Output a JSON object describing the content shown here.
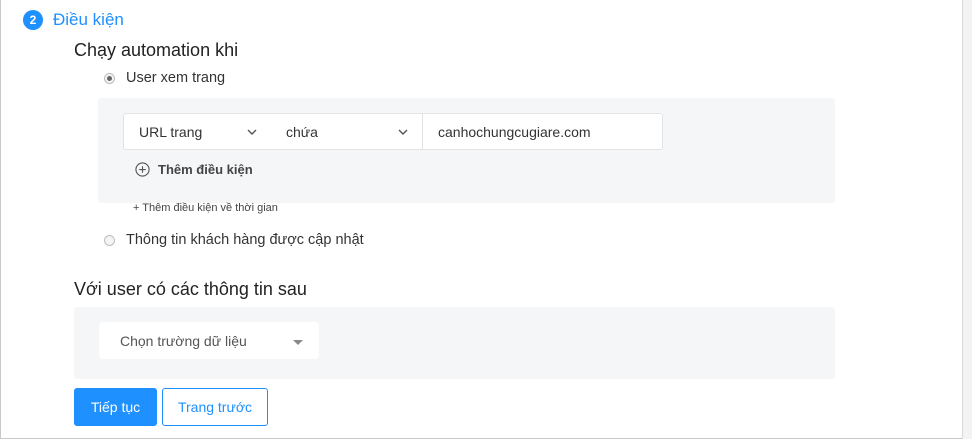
{
  "step": {
    "number": "2",
    "title": "Điều kiện"
  },
  "trigger": {
    "heading": "Chạy automation khi",
    "options": [
      {
        "label": "User xem trang",
        "selected": true
      },
      {
        "label": "Thông tin khách hàng được cập nhật",
        "selected": false
      }
    ],
    "condition": {
      "field": "URL trang",
      "operator": "chứa",
      "value": "canhochungcugiare.com"
    },
    "add_condition_label": "Thêm điều kiện",
    "add_time_condition_label": "+ Thêm điều kiện về thời gian"
  },
  "user_filter": {
    "heading": "Với user có các thông tin sau",
    "dropdown_placeholder": "Chọn trường dữ liệu"
  },
  "buttons": {
    "next": "Tiếp tục",
    "back": "Trang trước"
  },
  "colors": {
    "accent": "#1e90ff",
    "panel": "#f5f6f8"
  }
}
